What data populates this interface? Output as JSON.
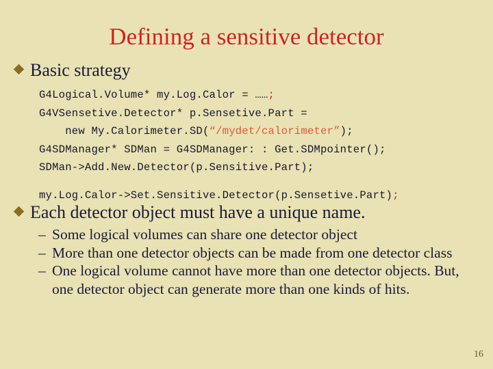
{
  "slide": {
    "title": "Defining a sensitive detector",
    "page_number": "16",
    "background_color": "#e8e2b4",
    "title_color": "#d81e1e",
    "bullet_marker_color": "#8a6d1f",
    "body_text_color": "#1a1a3a",
    "code_text_color": "#16162e",
    "code_string_color": "#e05a3a"
  },
  "bullets": [
    {
      "marker": "diamond-bullet",
      "label": "Basic strategy"
    },
    {
      "marker": "diamond-bullet",
      "label": "Each detector object must have a unique name."
    }
  ],
  "code": {
    "lines": [
      {
        "segments": [
          {
            "text": "G4Logical.Volume* my.Log.Calor = ……",
            "style": "plain"
          },
          {
            "text": ";",
            "style": "red"
          }
        ]
      },
      {
        "segments": [
          {
            "text": "G4VSensetive.Detector* p.Sensetive.Part =",
            "style": "plain"
          }
        ]
      },
      {
        "segments": [
          {
            "text": "    new My.Calorimeter.SD(",
            "style": "plain"
          },
          {
            "text": "“/mydet/calorimeter”",
            "style": "string"
          },
          {
            "text": ");",
            "style": "plain"
          }
        ]
      },
      {
        "segments": [
          {
            "text": "G4SDManager* SDMan = G4SDManager: : Get.SDMpointer();",
            "style": "plain"
          }
        ]
      },
      {
        "segments": [
          {
            "text": "SDMan->Add.New.Detector(p.Sensitive.Part);",
            "style": "plain"
          }
        ]
      },
      {
        "spaced": true,
        "segments": [
          {
            "text": "my.Log.Calor->Set.Sensitive.Detector(p.Sensetive.Part)",
            "style": "plain"
          },
          {
            "text": ";",
            "style": "red"
          }
        ]
      }
    ]
  },
  "sub_bullets": [
    {
      "dash": "–",
      "text": "Some logical volumes can share one detector object"
    },
    {
      "dash": "–",
      "text": "More than one detector objects can be made from one detector class"
    },
    {
      "dash": "–",
      "text": "One logical volume cannot have more than one detector objects. But, one detector object can generate more than one kinds of hits."
    }
  ]
}
